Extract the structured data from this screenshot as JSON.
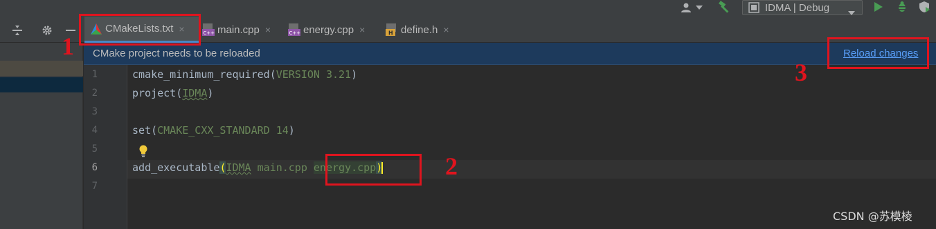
{
  "toolbar": {
    "run_config_label": "IDMA | Debug",
    "icons": [
      "user-icon",
      "dropdown-arrow-icon",
      "build-hammer-icon",
      "run-icon",
      "debug-icon",
      "coverage-icon"
    ]
  },
  "side_toolbar": {
    "icons": [
      "collapse-icon",
      "settings-gear-icon",
      "minimize-icon"
    ]
  },
  "tabs": [
    {
      "label": "CMakeLists.txt",
      "icon": "cmake-icon",
      "active": true,
      "close": "×"
    },
    {
      "label": "main.cpp",
      "icon": "cpp-file-icon",
      "active": false,
      "close": "×"
    },
    {
      "label": "energy.cpp",
      "icon": "cpp-file-icon",
      "active": false,
      "close": "×"
    },
    {
      "label": "define.h",
      "icon": "header-file-icon",
      "active": false,
      "close": "×"
    }
  ],
  "banner": {
    "message": "CMake project needs to be reloaded",
    "action_label": "Reload changes"
  },
  "editor": {
    "line_numbers": [
      "1",
      "2",
      "3",
      "4",
      "5",
      "6",
      "7"
    ],
    "current_line": 6,
    "lines": [
      {
        "fn": "cmake_minimum_required",
        "open": "(",
        "args": "VERSION 3.21",
        "close": ")"
      },
      {
        "fn": "project",
        "open": "(",
        "args": "IDMA",
        "close": ")"
      },
      {
        "text": ""
      },
      {
        "fn": "set",
        "open": "(",
        "args": "CMAKE_CXX_STANDARD 14",
        "close": ")"
      },
      {
        "text": ""
      },
      {
        "fn": "add_executable",
        "open": "(",
        "args_a": "IDMA",
        "args_b": " main.cpp ",
        "args_c": "energy.cpp",
        "close": ")"
      },
      {
        "text": ""
      }
    ]
  },
  "annotations": {
    "label_1": "1",
    "label_2": "2",
    "label_3": "3",
    "color": "#e0141e"
  },
  "watermark": "CSDN @苏模棱",
  "colors": {
    "editor_bg": "#2b2b2b",
    "banner_bg": "#1d3a5c",
    "link": "#589df6",
    "string_green": "#6a8759"
  }
}
